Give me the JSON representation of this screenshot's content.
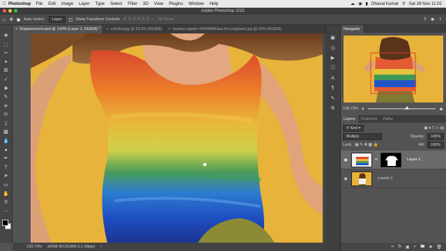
{
  "menubar": {
    "app": "Photoshop",
    "items": [
      "File",
      "Edit",
      "Image",
      "Layer",
      "Type",
      "Select",
      "Filter",
      "3D",
      "View",
      "Plugins",
      "Window",
      "Help"
    ],
    "user": "Dhaval Kumar",
    "datetime": "Sat 28 Nov  11:02"
  },
  "window": {
    "title": "Adobe Photoshop 2021"
  },
  "options": {
    "auto_select_label": "Auto-Select:",
    "auto_select_value": "Layer",
    "transform_label": "Show Transform Controls",
    "mode_label": "3D Mode:"
  },
  "tabs": [
    {
      "label": "Displacement.psd @ 140% (Layer 1, RGB/8) *"
    },
    {
      "label": "colorful.jpg @ 33.3% (RGB/8)"
    },
    {
      "label": "markus-spiske-4W5WWKaus Ks-unsplash.jpg @ 25% (RGB/8)"
    }
  ],
  "tools": [
    "move-icon",
    "marquee-icon",
    "lasso-icon",
    "quick-select-icon",
    "crop-icon",
    "eyedropper-icon",
    "healing-icon",
    "brush-icon",
    "stamp-icon",
    "history-brush-icon",
    "eraser-icon",
    "gradient-icon",
    "blur-icon",
    "dodge-icon",
    "pen-icon",
    "type-icon",
    "path-select-icon",
    "shape-icon",
    "hand-icon",
    "zoom-icon",
    "more-icon"
  ],
  "status": {
    "zoom": "139.73%",
    "profile": "sRGB IEC61966-2.1 (8bpc)"
  },
  "navigator": {
    "tab": "Navigator",
    "zoom": "139.73%",
    "zoom_level": 0.55
  },
  "layers_panel": {
    "tabs": [
      "Layers",
      "Channels",
      "Paths"
    ],
    "filter": "Kind",
    "blend_mode": "Multiply",
    "opacity_label": "Opacity:",
    "opacity": "100%",
    "lock_label": "Lock:",
    "fill_label": "Fill:",
    "fill": "100%",
    "layers": [
      {
        "name": "Layer 1",
        "selected": true
      },
      {
        "name": "Levels 1",
        "selected": false
      }
    ]
  },
  "colors": {
    "accent": "#e7b33a",
    "panel": "#535353"
  }
}
